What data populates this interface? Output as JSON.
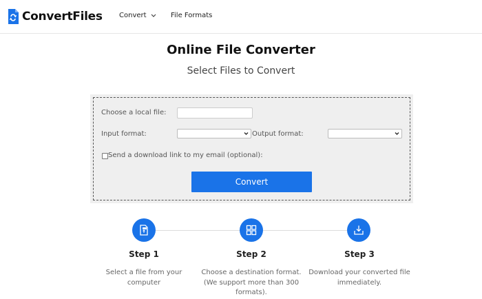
{
  "header": {
    "brand": "ConvertFiles",
    "nav": [
      {
        "label": "Convert"
      },
      {
        "label": "File Formats"
      }
    ]
  },
  "main": {
    "title": "Online File Converter",
    "subtitle": "Select Files to Convert"
  },
  "form": {
    "local_file_label": "Choose a local file:",
    "input_format_label": "Input format:",
    "output_format_label": "Output format:",
    "email_label": "Send a download link to my email (optional):",
    "convert_label": "Convert",
    "input_format_value": "",
    "output_format_value": ""
  },
  "steps": [
    {
      "title": "Step 1",
      "desc_lines": [
        "Select a file from your",
        "computer"
      ]
    },
    {
      "title": "Step 2",
      "desc_lines": [
        "Choose a destination format.",
        "(We support more than 300",
        "formats)."
      ]
    },
    {
      "title": "Step 3",
      "desc_lines": [
        "Download your converted file",
        "immediately."
      ]
    }
  ],
  "colors": {
    "accent": "#1a73e8",
    "panel_bg": "#efefef"
  }
}
